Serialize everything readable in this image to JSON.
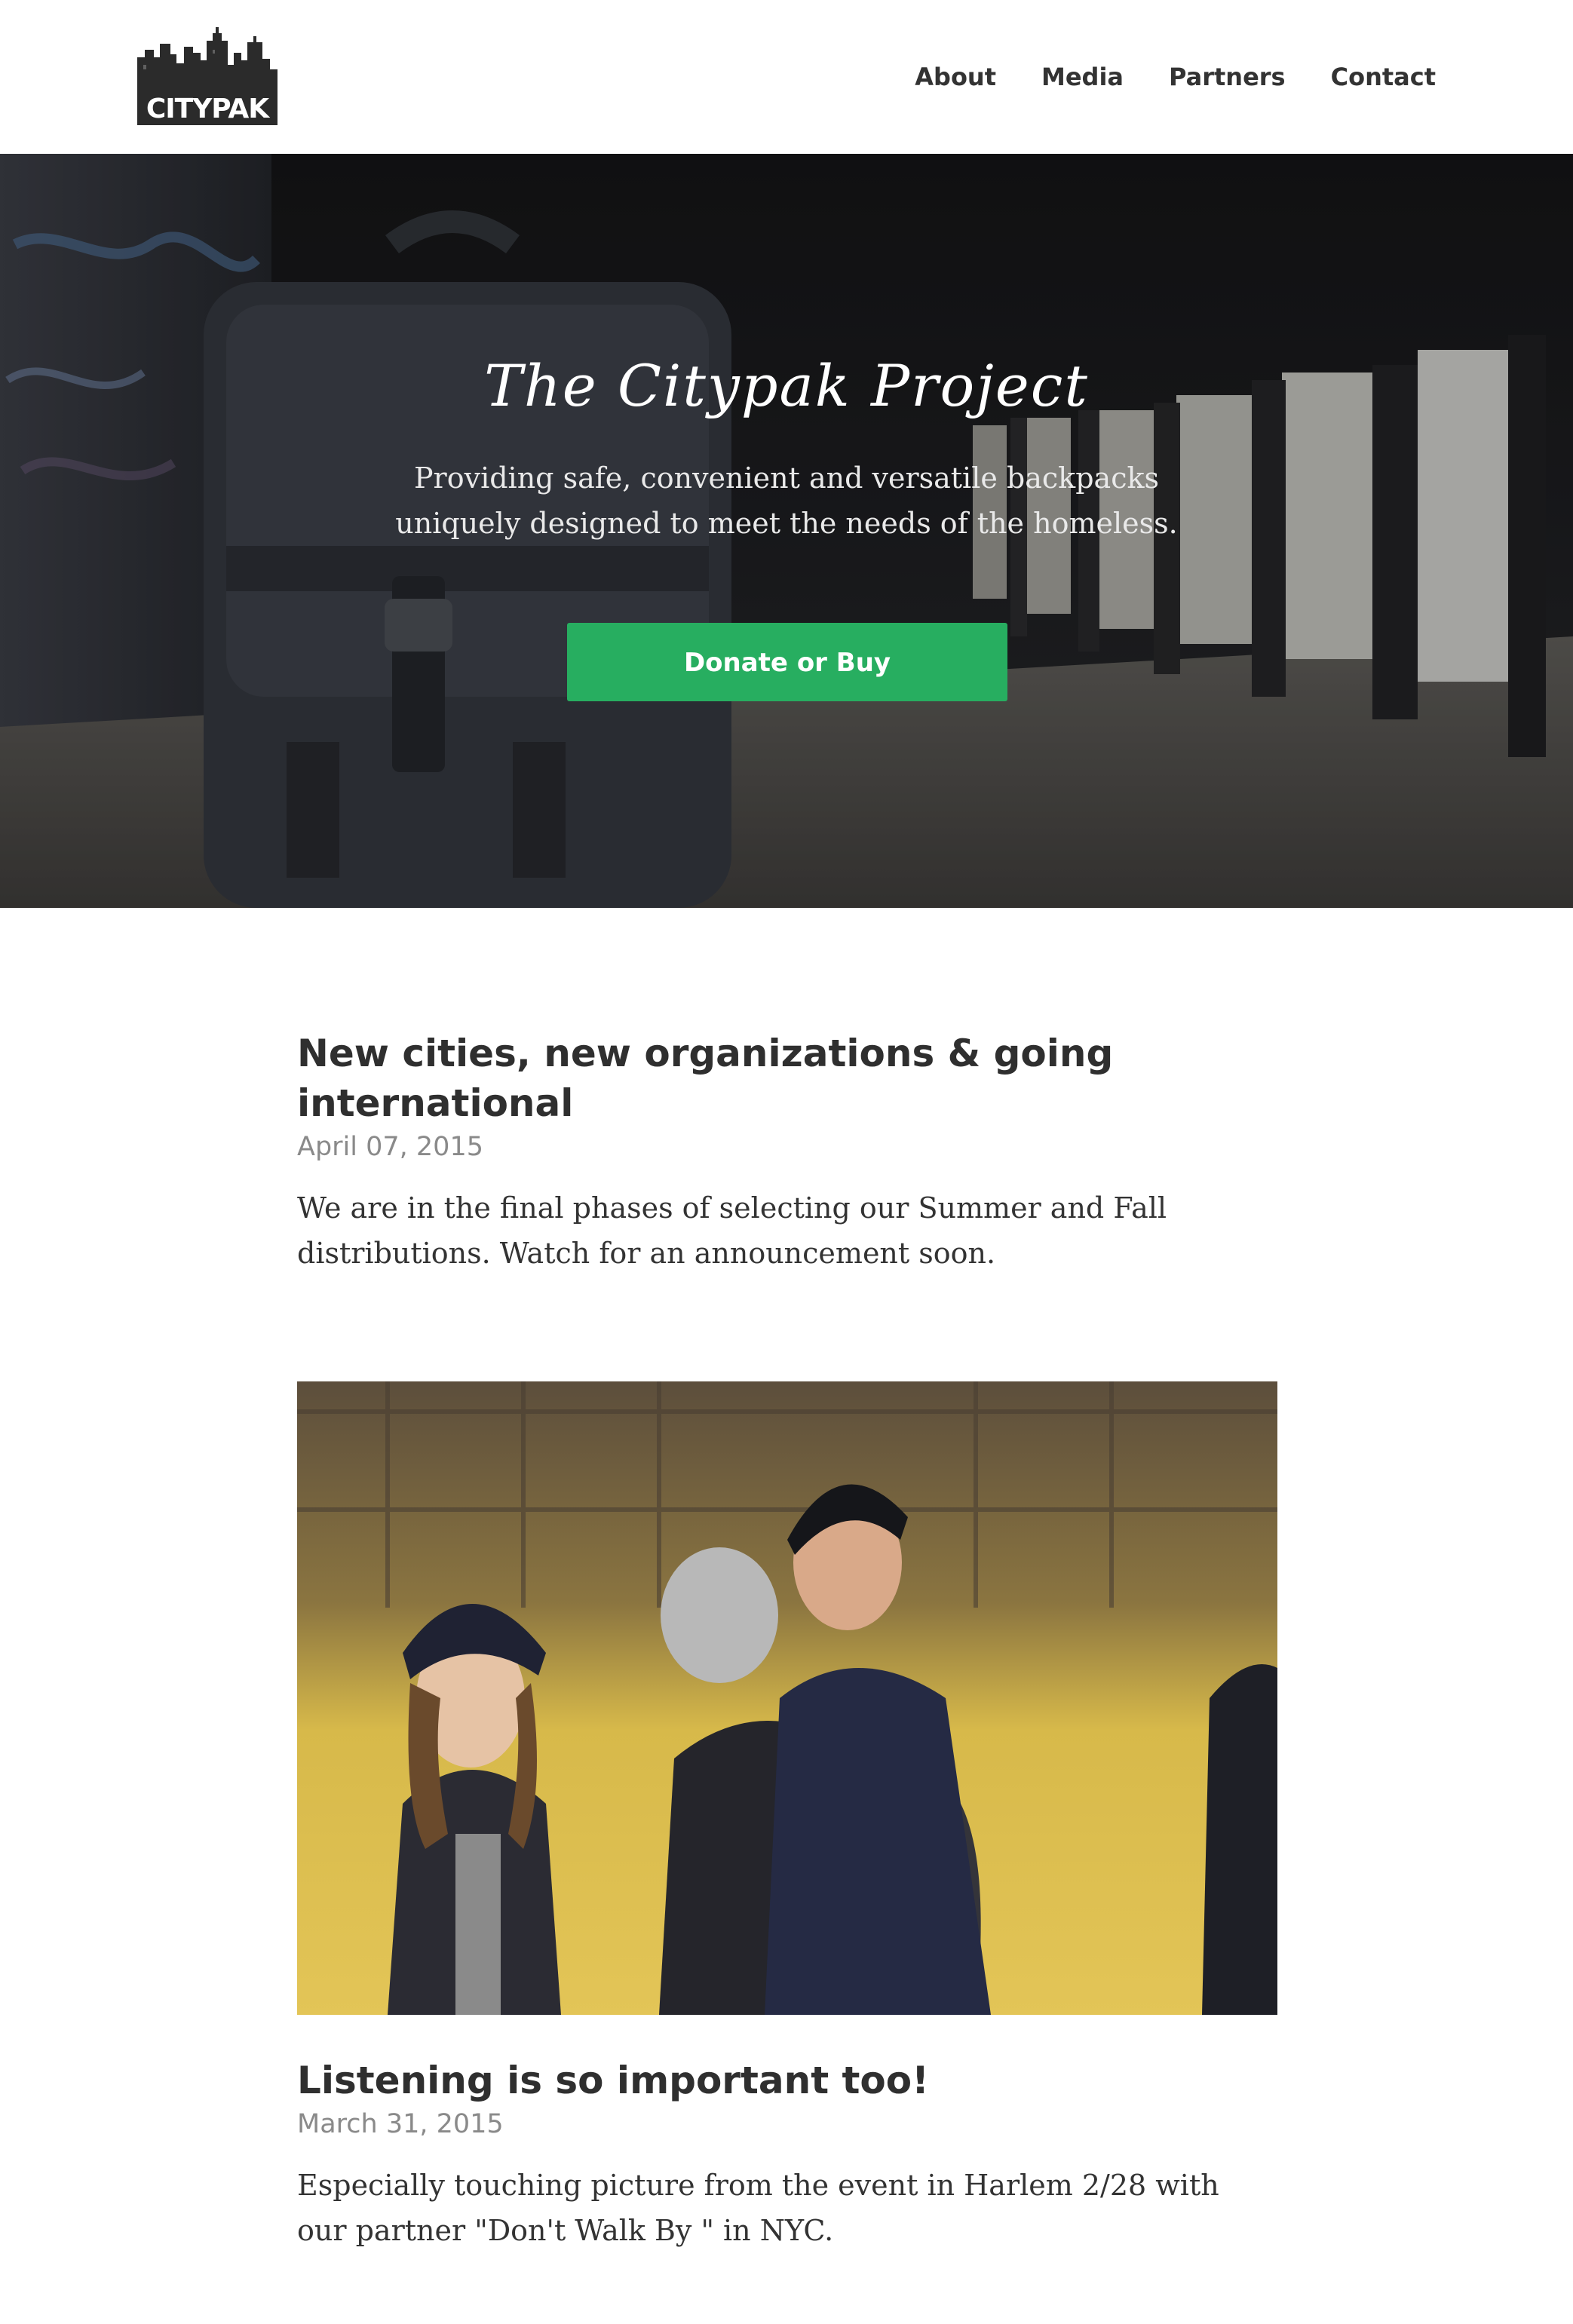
{
  "header": {
    "logo_text": "CITYPAK",
    "nav": [
      {
        "label": "About"
      },
      {
        "label": "Media"
      },
      {
        "label": "Partners"
      },
      {
        "label": "Contact"
      }
    ]
  },
  "hero": {
    "title": "The Citypak Project",
    "subtitle": "Providing safe, convenient and versatile backpacks uniquely designed to meet the needs of the homeless.",
    "cta_label": "Donate or Buy",
    "accent_color": "#27ae60"
  },
  "posts": [
    {
      "title": "New cities, new organizations & going international",
      "date": "April 07, 2015",
      "body": "We are in the final phases of selecting our Summer and Fall distributions. Watch for an announcement soon."
    },
    {
      "title": "Listening is so important too!",
      "date": "March 31, 2015",
      "body": "Especially touching picture from the event in Harlem 2/28 with our partner \"Don't Walk By \" in NYC."
    }
  ]
}
